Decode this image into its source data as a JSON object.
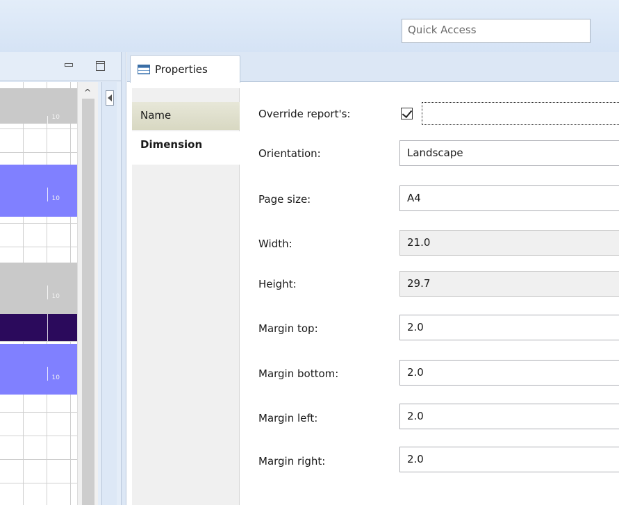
{
  "toolbar": {
    "quick_access_placeholder": "Quick Access"
  },
  "editor": {
    "band_numbers": [
      "10",
      "10",
      "10",
      "10"
    ]
  },
  "properties_view": {
    "tab_label": "Properties",
    "categories": [
      {
        "label": "Name",
        "selected": false
      },
      {
        "label": "Dimension",
        "selected": true
      }
    ],
    "override_label": "Override report's:",
    "override_checked": true,
    "fields": [
      {
        "label": "Orientation:",
        "value": "Landscape",
        "readonly": false
      },
      {
        "label": "Page size:",
        "value": "A4",
        "readonly": false
      },
      {
        "label": "Width:",
        "value": "21.0",
        "readonly": true
      },
      {
        "label": "Height:",
        "value": "29.7",
        "readonly": true
      },
      {
        "label": "Margin top:",
        "value": "2.0",
        "readonly": false
      },
      {
        "label": "Margin bottom:",
        "value": "2.0",
        "readonly": false
      },
      {
        "label": "Margin left:",
        "value": "2.0",
        "readonly": false
      },
      {
        "label": "Margin right:",
        "value": "2.0",
        "readonly": false
      }
    ]
  },
  "colors": {
    "band_gray": "#c9c9c9",
    "band_blue": "#8080ff",
    "band_dark": "#2b0a5c",
    "toolbar_bg": "#dce7f5"
  }
}
